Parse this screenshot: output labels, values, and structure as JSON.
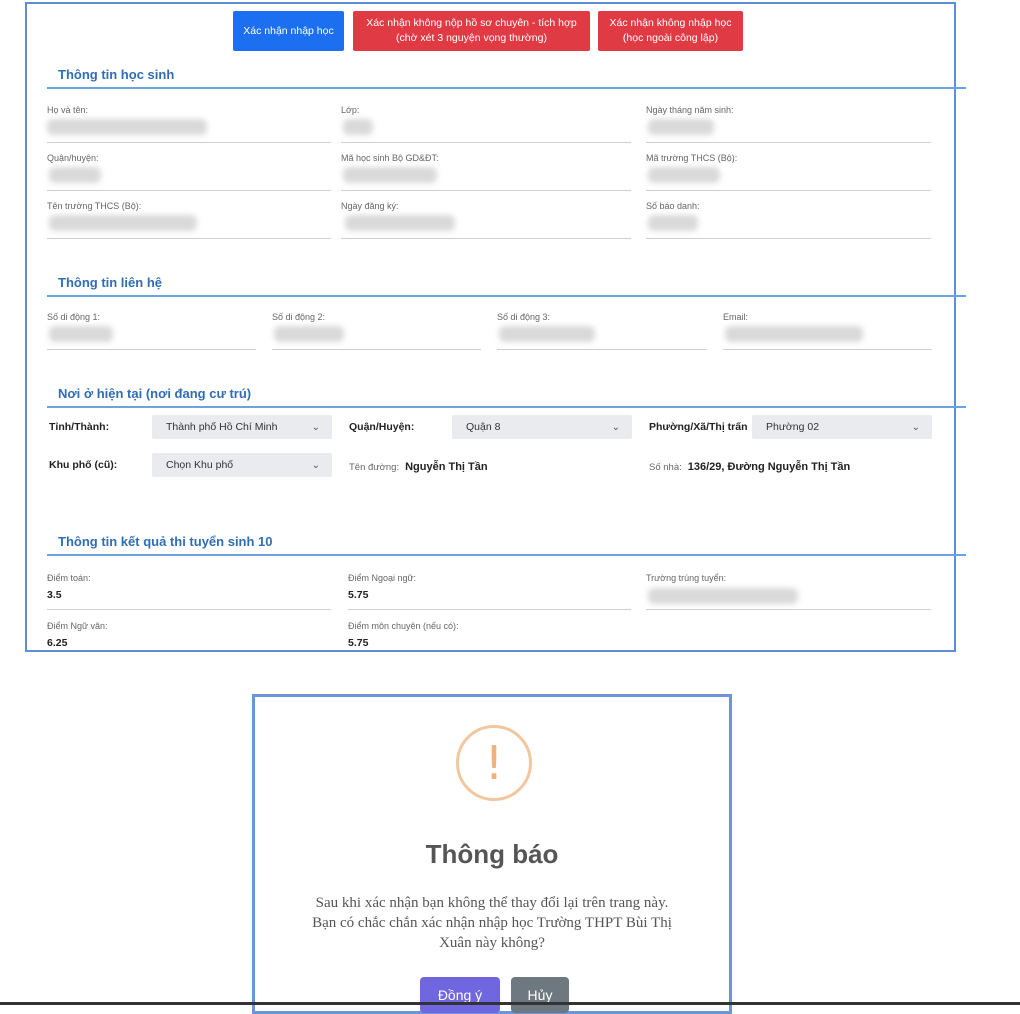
{
  "actions": {
    "confirm_enroll": "Xác nhận nhập học",
    "confirm_no_specialized_line1": "Xác nhận không nộp hồ sơ chuyên - tích hợp",
    "confirm_no_specialized_line2": "(chờ xét 3 nguyện vọng thường)",
    "confirm_not_enroll_line1": "Xác nhận không nhập học",
    "confirm_not_enroll_line2": "(học ngoài công lập)"
  },
  "student_info": {
    "title": "Thông tin học sinh",
    "labels": {
      "full_name": "Họ và tên:",
      "class": "Lớp:",
      "dob": "Ngày tháng năm sinh:",
      "district": "Quận/huyện:",
      "student_code": "Mã học sinh Bộ GD&ĐT:",
      "school_code": "Mã trường THCS (Bộ):",
      "school_name": "Tên trường THCS (Bộ):",
      "registration_date": "Ngày đăng ký:",
      "candidate_number": "Số báo danh:"
    }
  },
  "contact_info": {
    "title": "Thông tin liên hệ",
    "labels": {
      "phone1": "Số di động 1:",
      "phone2": "Số di động 2:",
      "phone3": "Số di động 3:",
      "email": "Email:"
    }
  },
  "residence": {
    "title": "Nơi ở hiện tại (nơi đang cư trú)",
    "province_label": "Tỉnh/Thành:",
    "province_value": "Thành phố Hồ Chí Minh",
    "district_label": "Quận/Huyện:",
    "district_value": "Quận 8",
    "ward_label": "Phường/Xã/Thị trấn",
    "ward_value": "Phường 02",
    "neighborhood_label": "Khu phố (cũ):",
    "neighborhood_value": "Chọn Khu phố",
    "street_label": "Tên đường:",
    "street_value": "Nguyễn Thị Tần",
    "house_label": "Số nhà:",
    "house_value": "136/29, Đường Nguyễn Thị Tần"
  },
  "results": {
    "title": "Thông tin kết quả thi tuyển sinh 10",
    "math_label": "Điểm toán:",
    "math_value": "3.5",
    "foreign_label": "Điểm Ngoại ngữ:",
    "foreign_value": "5.75",
    "admitted_school_label": "Trường trúng tuyển:",
    "literature_label": "Điểm Ngữ văn:",
    "literature_value": "6.25",
    "specialized_label": "Điểm môn chuyên (nếu có):",
    "specialized_value": "5.75"
  },
  "dialog": {
    "icon_glyph": "!",
    "title": "Thông báo",
    "message_line1": "Sau khi xác nhận bạn không thể thay đổi lại trên trang này.",
    "message_line2": "Bạn có chắc chắn xác nhận nhập học Trường THPT Bùi Thị",
    "message_line3": "Xuân này không?",
    "ok_label": "Đồng ý",
    "cancel_label": "Hủy"
  },
  "colors": {
    "primary_blue": "#1d6ff2",
    "danger_red": "#e03a45",
    "section_title": "#2f6db5",
    "ok_button": "#7066e0",
    "cancel_button": "#6e7881",
    "warning_icon": "#f0b27a"
  },
  "icons": {
    "select_chevron": "chevron-down-icon",
    "dialog_icon": "warning-icon"
  }
}
